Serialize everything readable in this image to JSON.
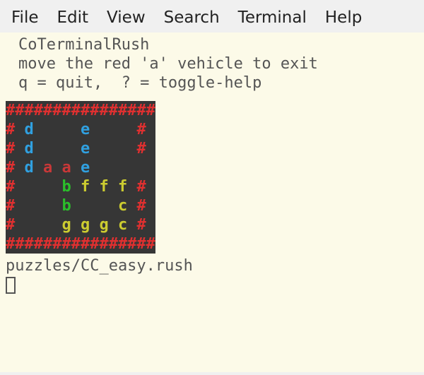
{
  "menubar": {
    "file": "File",
    "edit": "Edit",
    "view": "View",
    "search": "Search",
    "terminal": "Terminal",
    "help": "Help"
  },
  "header": {
    "title": "CoTerminalRush",
    "goal": "move the red 'a' vehicle to exit",
    "keys": "q = quit,  ? = toggle-help"
  },
  "board": {
    "width": 6,
    "height": 6,
    "exit_row": 2,
    "rows_raw": [
      "################",
      "# d     e     #",
      "# d     e     #",
      "# d a a e     ",
      "#     b f f f #",
      "#     b     c #",
      "#     g g g c #",
      "################"
    ],
    "vehicles": [
      {
        "id": "a",
        "color": "red",
        "cells": [
          [
            2,
            1
          ],
          [
            2,
            2
          ]
        ],
        "orient": "h",
        "goal": true
      },
      {
        "id": "b",
        "color": "green",
        "cells": [
          [
            3,
            2
          ],
          [
            4,
            2
          ]
        ],
        "orient": "v"
      },
      {
        "id": "c",
        "color": "yellow",
        "cells": [
          [
            4,
            5
          ],
          [
            5,
            5
          ]
        ],
        "orient": "v"
      },
      {
        "id": "d",
        "color": "blue",
        "cells": [
          [
            0,
            0
          ],
          [
            1,
            0
          ],
          [
            2,
            0
          ]
        ],
        "orient": "v"
      },
      {
        "id": "e",
        "color": "blue",
        "cells": [
          [
            0,
            3
          ],
          [
            1,
            3
          ],
          [
            2,
            3
          ]
        ],
        "orient": "v"
      },
      {
        "id": "f",
        "color": "yellow",
        "cells": [
          [
            3,
            3
          ],
          [
            3,
            4
          ],
          [
            3,
            5
          ]
        ],
        "orient": "h"
      },
      {
        "id": "g",
        "color": "yellow",
        "cells": [
          [
            5,
            2
          ],
          [
            5,
            3
          ],
          [
            5,
            4
          ]
        ],
        "orient": "h"
      }
    ]
  },
  "footer": {
    "path": "puzzles/CC_easy.rush"
  }
}
